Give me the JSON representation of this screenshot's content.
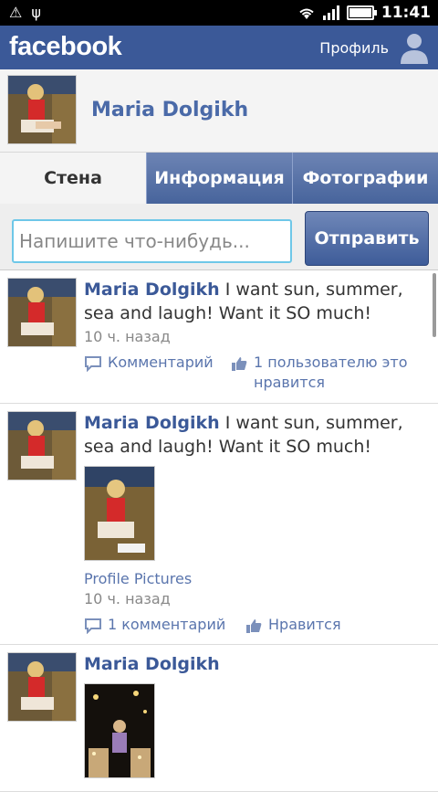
{
  "status_bar": {
    "time": "11:41"
  },
  "top_bar": {
    "logo": "facebook",
    "profile_link": "Профиль"
  },
  "profile": {
    "name": "Maria Dolgikh"
  },
  "tabs": [
    {
      "label": "Стена",
      "active": true
    },
    {
      "label": "Информация",
      "active": false
    },
    {
      "label": "Фотографии",
      "active": false
    }
  ],
  "compose": {
    "placeholder": "Напишите что-нибудь...",
    "send_label": "Отправить"
  },
  "posts": [
    {
      "author": "Maria Dolgikh",
      "text": " I want sun, summer, sea and laugh! Want it SO  much!",
      "time": "10 ч. назад",
      "comment_label": "Комментарий",
      "like_label": "1 пользователю это нравится"
    },
    {
      "author": "Maria Dolgikh",
      "text": " I want sun, summer, sea and laugh! Want it SO much!",
      "album": "Profile Pictures",
      "time": "10 ч. назад",
      "comment_label": "1 комментарий",
      "like_label": "Нравится"
    },
    {
      "author": "Maria Dolgikh",
      "text": ""
    }
  ]
}
